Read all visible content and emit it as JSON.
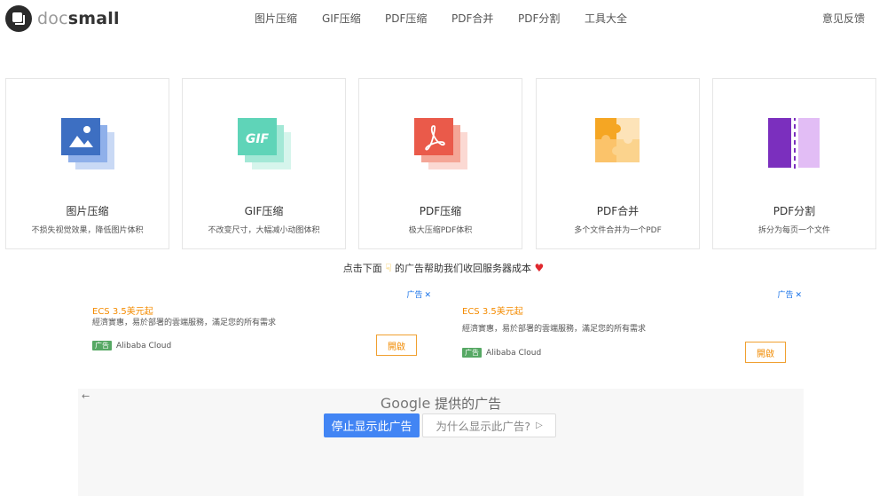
{
  "header": {
    "logo_doc": "doc",
    "logo_small": "small",
    "nav": [
      "图片压缩",
      "GIF压缩",
      "PDF压缩",
      "PDF合并",
      "PDF分割",
      "工具大全"
    ],
    "feedback": "意见反馈"
  },
  "cards": [
    {
      "icon": "image-compress-icon",
      "title": "图片压缩",
      "desc": "不损失视觉效果，降低图片体积"
    },
    {
      "icon": "gif-compress-icon",
      "title": "GIF压缩",
      "desc": "不改变尺寸，大幅减小动图体积"
    },
    {
      "icon": "pdf-compress-icon",
      "title": "PDF压缩",
      "desc": "极大压缩PDF体积"
    },
    {
      "icon": "pdf-merge-icon",
      "title": "PDF合并",
      "desc": "多个文件合并为一个PDF"
    },
    {
      "icon": "pdf-split-icon",
      "title": "PDF分割",
      "desc": "拆分为每页一个文件"
    }
  ],
  "donate": {
    "before": "点击下面",
    "after": "的广告帮助我们收回服务器成本"
  },
  "ads": [
    {
      "adchoice": "广告",
      "title": "ECS 3.5美元起",
      "body": "經濟實惠，易於部署的雲端服務，滿足您的所有需求",
      "badge": "广告",
      "advertiser": "Alibaba Cloud",
      "button": "開啟"
    },
    {
      "adchoice": "广告",
      "title": "ECS 3.5美元起",
      "body": "經濟實惠，易於部署的雲端服務，滿足您的所有需求",
      "badge": "广告",
      "advertiser": "Alibaba Cloud",
      "button": "開啟"
    }
  ],
  "google_panel": {
    "google": "Google",
    "provided": " 提供的广告",
    "stop_button": "停止显示此广告",
    "why_button": "为什么显示此广告?"
  },
  "colors": {
    "image_blue": "#3d6fc2",
    "gif_teal": "#5fd4b8",
    "pdf_red": "#ea5a4a",
    "merge_orange": "#f5a623",
    "split_purple": "#7b2fbe",
    "ad_orange": "#f48b00",
    "google_blue": "#4285f4"
  }
}
